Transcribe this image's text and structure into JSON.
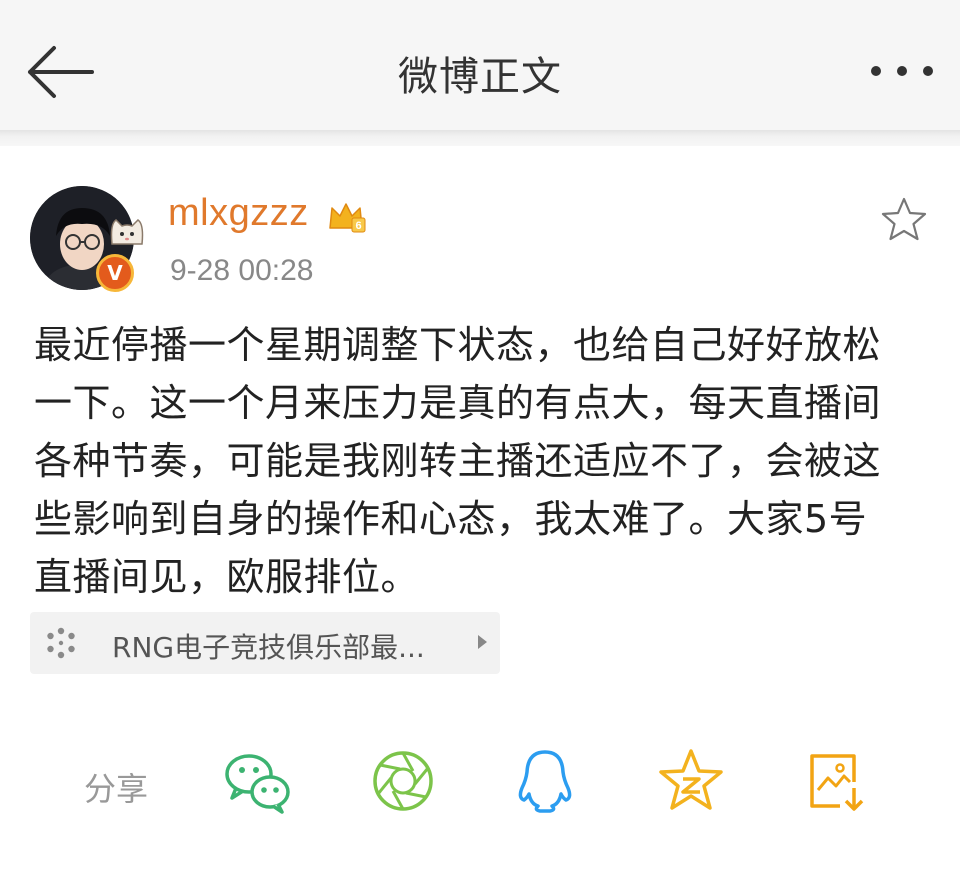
{
  "header": {
    "title": "微博正文",
    "back_icon": "arrow-left-icon",
    "more_icon": "more-dots-icon"
  },
  "post": {
    "username": "mlxgzzz",
    "timestamp": "9-28 00:28",
    "verified_label": "V",
    "vip_level": "6",
    "body": "最近停播一个星期调整下状态，也给自己好好放松\n一下。这一个月来压力是真的有点大，每天直播间\n各种节奏，可能是我刚转主播还适应不了，会被这\n些影响到自身的操作和心态，我太难了。大家5号\n直播间见，欧服排位。",
    "link_card": {
      "text": "RNG电子竞技俱乐部最..."
    }
  },
  "share": {
    "label": "分享",
    "targets": [
      "wechat",
      "moments",
      "qq",
      "qzone",
      "save-image"
    ]
  },
  "colors": {
    "username": "#e0792c",
    "wechat": "#3cb371",
    "moments": "#7cc44a",
    "qq": "#2c9df0",
    "qzone": "#f3b21e",
    "save": "#f2a413"
  }
}
